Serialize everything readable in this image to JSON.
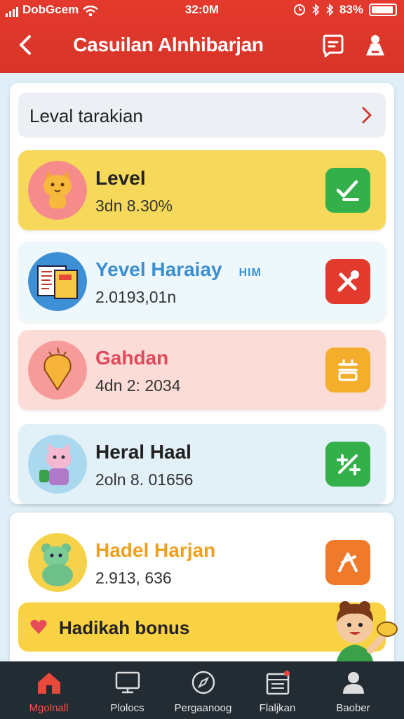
{
  "status_bar": {
    "carrier": "DobGcem",
    "time": "32:0M",
    "battery": "83%"
  },
  "header": {
    "title": "Casuilan Alnhibarjan"
  },
  "level_bar": {
    "label": "Leval tarakian"
  },
  "cards": [
    {
      "title": "Level",
      "subtitle": "3dn 8.30%",
      "tag": "",
      "title_color": "#222222",
      "bg": "#f6d95a",
      "action_color": "#33b04a",
      "avatar_bg": "#f58b8b"
    },
    {
      "title": "Yevel Haraiay",
      "subtitle": "2.0193,01n",
      "tag": "HIM",
      "title_color": "#3b8fd0",
      "bg": "#eef8fc",
      "action_color": "#e23a2c",
      "avatar_bg": "#3d8fd6"
    },
    {
      "title": "Gahdan",
      "subtitle": "4dn 2: 2034",
      "tag": "",
      "title_color": "#e0495c",
      "bg": "#fbdcd6",
      "action_color": "#f5ae2c",
      "avatar_bg": "#f79a9a"
    },
    {
      "title": "Heral Haal",
      "subtitle": "2oln 8. 01656",
      "tag": "",
      "title_color": "#222222",
      "bg": "#e2f0f8",
      "action_color": "#33b04a",
      "avatar_bg": "#a9d8ef"
    },
    {
      "title": "Hadel Harjan",
      "subtitle": "2.913, 636",
      "tag": "",
      "title_color": "#f0a020",
      "bg": "#ffffff",
      "action_color": "#f07a2c",
      "avatar_bg": "#f5d24a"
    }
  ],
  "bonus": {
    "label": "Hadikah bonus"
  },
  "tabs": [
    {
      "label": "Mgolnall",
      "icon": "home-icon",
      "active": true
    },
    {
      "label": "Plolocs",
      "icon": "monitor-icon"
    },
    {
      "label": "Pergaanoog",
      "icon": "compass-icon"
    },
    {
      "label": "Flaljkan",
      "icon": "calendar-icon"
    },
    {
      "label": "Baober",
      "icon": "person-icon"
    }
  ]
}
